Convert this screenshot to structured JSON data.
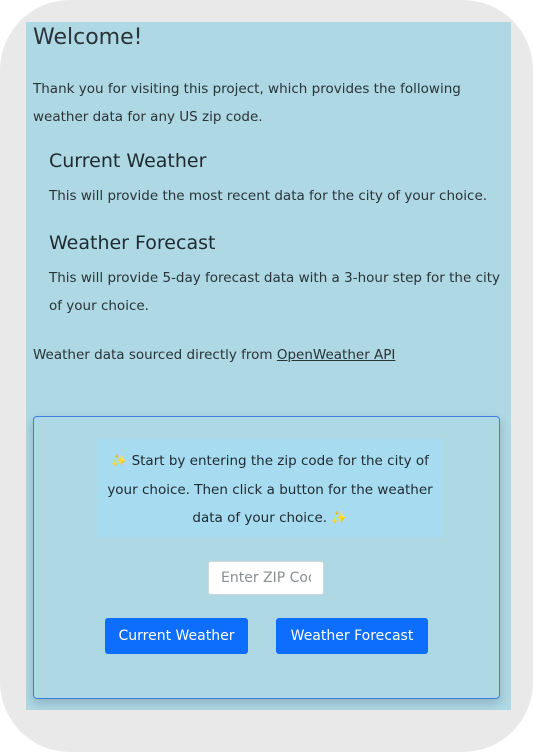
{
  "welcome": {
    "title": "Welcome!"
  },
  "intro": {
    "text": "Thank you for visiting this project, which provides the following weather data for any US zip code."
  },
  "sections": [
    {
      "heading": "Current Weather",
      "description": "This will provide the most recent data for the city of your choice."
    },
    {
      "heading": "Weather Forecast",
      "description": "This will provide 5-day forecast data with a 3-hour step for the city of your choice."
    }
  ],
  "source": {
    "prefix": "Weather data sourced directly from ",
    "link_label": "OpenWeather API"
  },
  "card": {
    "note_text": "Start by entering the zip code for the city of your choice. Then click a button for the weather data of your choice.",
    "sparkle_glyph": "✨",
    "zip_placeholder": "Enter ZIP Code",
    "current_button_label": "Current Weather",
    "forecast_button_label": "Weather Forecast"
  },
  "colors": {
    "panel_background": "#add8e4",
    "note_background": "#a6dbf0",
    "button_primary": "#0d6efd",
    "card_border": "#3c7fe0"
  },
  "icons": {
    "sparkle": "sparkles-icon"
  }
}
